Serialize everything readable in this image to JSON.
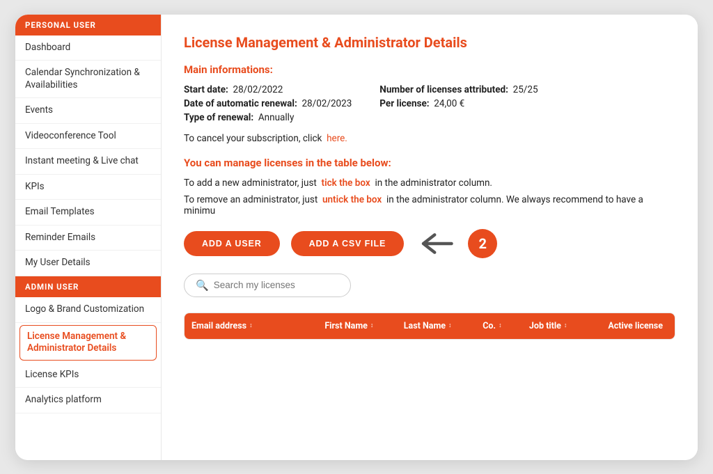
{
  "sidebar": {
    "personal_user_header": "PERSONAL USER",
    "admin_user_header": "ADMIN USER",
    "personal_items": [
      {
        "id": "dashboard",
        "label": "Dashboard"
      },
      {
        "id": "calendar-sync",
        "label": "Calendar Synchronization & Availabilities"
      },
      {
        "id": "events",
        "label": "Events"
      },
      {
        "id": "videoconference",
        "label": "Videoconference Tool"
      },
      {
        "id": "instant-meeting",
        "label": "Instant meeting & Live chat"
      },
      {
        "id": "kpis",
        "label": "KPIs"
      },
      {
        "id": "email-templates",
        "label": "Email Templates"
      },
      {
        "id": "reminder-emails",
        "label": "Reminder Emails"
      },
      {
        "id": "my-user-details",
        "label": "My User Details"
      }
    ],
    "admin_items": [
      {
        "id": "logo-brand",
        "label": "Logo & Brand Customization"
      },
      {
        "id": "license-management",
        "label": "License Management & Administrator Details",
        "active": true
      },
      {
        "id": "license-kpis",
        "label": "License KPIs"
      },
      {
        "id": "analytics",
        "label": "Analytics platform"
      }
    ]
  },
  "main": {
    "page_title": "License Management & Administrator Details",
    "main_info_title": "Main informations:",
    "start_date_label": "Start date:",
    "start_date_value": "28/02/2022",
    "auto_renewal_label": "Date of automatic renewal:",
    "auto_renewal_value": "28/02/2023",
    "renewal_type_label": "Type of renewal:",
    "renewal_type_value": "Annually",
    "num_licenses_label": "Number of licenses attributed:",
    "num_licenses_value": "25/25",
    "per_license_label": "Per license:",
    "per_license_value": "24,00 €",
    "cancel_text": "To cancel your subscription, click",
    "cancel_link": "here.",
    "manage_title": "You can manage licenses in the table below:",
    "add_admin_text": "To add a new administrator, just",
    "tick_link": "tick the box",
    "add_admin_text2": "in the administrator column.",
    "remove_admin_text": "To remove an administrator, just",
    "untick_link": "untick the box",
    "remove_admin_text2": "in the administrator column. We always recommend to have a minimu",
    "btn_add_user": "ADD A USER",
    "btn_add_csv": "ADD A CSV FILE",
    "badge_number": "2",
    "search_placeholder": "Search my licenses",
    "table": {
      "headers": [
        {
          "id": "email",
          "label": "Email address"
        },
        {
          "id": "firstname",
          "label": "First Name"
        },
        {
          "id": "lastname",
          "label": "Last Name"
        },
        {
          "id": "co",
          "label": "Co."
        },
        {
          "id": "jobtitle",
          "label": "Job title"
        },
        {
          "id": "active",
          "label": "Active license"
        }
      ]
    }
  }
}
